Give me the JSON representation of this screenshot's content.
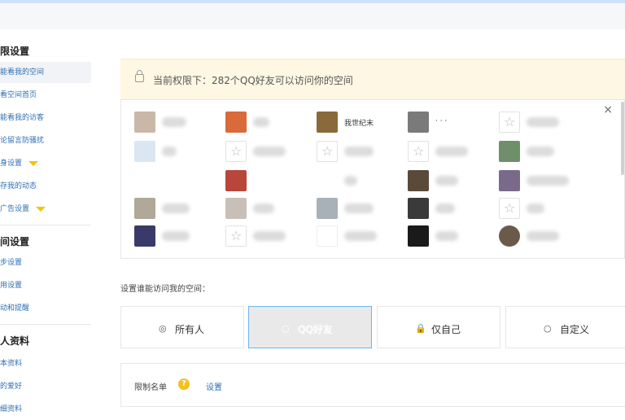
{
  "sidebar": {
    "sections": [
      {
        "title": "限设置",
        "items": [
          {
            "label": "能看我的空间",
            "active": true
          },
          {
            "label": "看空间首页"
          },
          {
            "label": "能看我的访客"
          },
          {
            "label": "论留言防骚扰"
          },
          {
            "label": "身设置",
            "vip": true
          },
          {
            "label": "存我的动态"
          },
          {
            "label": "广告设置",
            "vip": true
          }
        ]
      },
      {
        "title": "间设置",
        "items": [
          {
            "label": "步设置"
          },
          {
            "label": "用设置"
          },
          {
            "label": "动和提醒"
          }
        ]
      },
      {
        "title": "人资料",
        "items": [
          {
            "label": "本资料"
          },
          {
            "label": "的爱好"
          },
          {
            "label": "细资料"
          }
        ]
      }
    ]
  },
  "notice": {
    "text": "当前权限下：282个QQ好友可以访问你的空间"
  },
  "friends_panel": {
    "close_label": "×",
    "visible_names": [
      "我世纪末",
      "· · ·"
    ]
  },
  "setting": {
    "label": "设置谁能访问我的空间：",
    "options": [
      {
        "label": "所有人",
        "icon": "◎"
      },
      {
        "label": "QQ好友",
        "icon": "○",
        "selected": true
      },
      {
        "label": "仅自己",
        "icon": "🔒"
      },
      {
        "label": "自定义",
        "icon": "○"
      }
    ]
  },
  "blacklist": {
    "label": "限制名单",
    "help": "?",
    "link": "设置"
  },
  "colors": {
    "link": "#2f6fb3",
    "notice_bg": "#fdf7e3",
    "selected_border": "#6bb6ef",
    "vip_gold": "#f5c20a"
  }
}
